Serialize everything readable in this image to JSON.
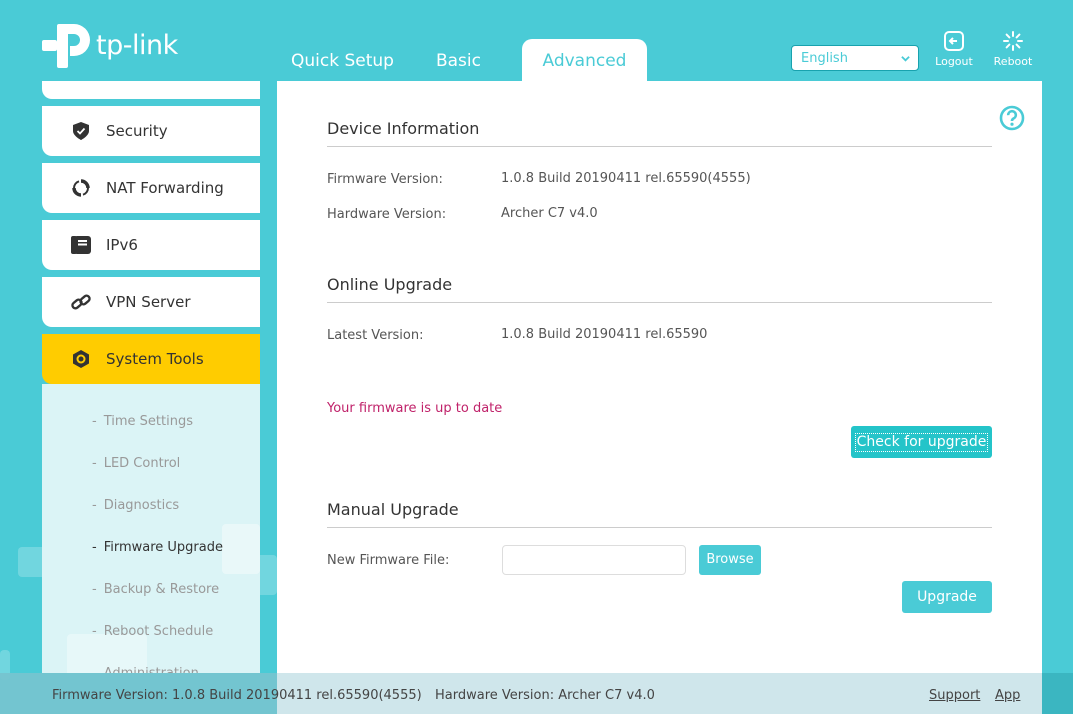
{
  "brand": {
    "logo_text": "tp-link",
    "accent_color": "#4acbd6",
    "active_nav_color": "#ffcc00",
    "alert_text_color": "#c0226a"
  },
  "header": {
    "tabs": [
      {
        "label": "Quick Setup",
        "active": false
      },
      {
        "label": "Basic",
        "active": false
      },
      {
        "label": "Advanced",
        "active": true
      }
    ],
    "language": {
      "selected": "English",
      "icon": "chevron-down-icon"
    },
    "logout": {
      "label": "Logout",
      "icon": "logout-icon"
    },
    "reboot": {
      "label": "Reboot",
      "icon": "reboot-icon"
    }
  },
  "sidebar": {
    "items": [
      {
        "label": "Security",
        "icon": "shield-icon"
      },
      {
        "label": "NAT Forwarding",
        "icon": "refresh-arrows-icon"
      },
      {
        "label": "IPv6",
        "icon": "document-icon"
      },
      {
        "label": "VPN Server",
        "icon": "link-icon"
      },
      {
        "label": "System Tools",
        "icon": "gear-icon",
        "active": true
      }
    ],
    "submenu": [
      {
        "label": "Time Settings"
      },
      {
        "label": "LED Control"
      },
      {
        "label": "Diagnostics"
      },
      {
        "label": "Firmware Upgrade",
        "active": true
      },
      {
        "label": "Backup & Restore"
      },
      {
        "label": "Reboot Schedule"
      },
      {
        "label": "Administration"
      }
    ],
    "dash": "-"
  },
  "main": {
    "help_icon": "help-icon",
    "device_info": {
      "title": "Device Information",
      "firmware_label": "Firmware Version:",
      "firmware_value": "1.0.8 Build 20190411 rel.65590(4555)",
      "hardware_label": "Hardware Version:",
      "hardware_value": "Archer C7 v4.0"
    },
    "online_upgrade": {
      "title": "Online Upgrade",
      "latest_label": "Latest Version:",
      "latest_value": "1.0.8 Build 20190411 rel.65590",
      "status": "Your firmware is up to date",
      "check_button": "Check for upgrade"
    },
    "manual_upgrade": {
      "title": "Manual Upgrade",
      "file_label": "New Firmware File:",
      "file_value": "",
      "browse_button": "Browse",
      "upgrade_button": "Upgrade"
    }
  },
  "footer": {
    "firmware": "Firmware Version: 1.0.8 Build 20190411 rel.65590(4555)",
    "hardware": "Hardware Version: Archer C7 v4.0",
    "support_link": "Support",
    "app_link": "App"
  }
}
